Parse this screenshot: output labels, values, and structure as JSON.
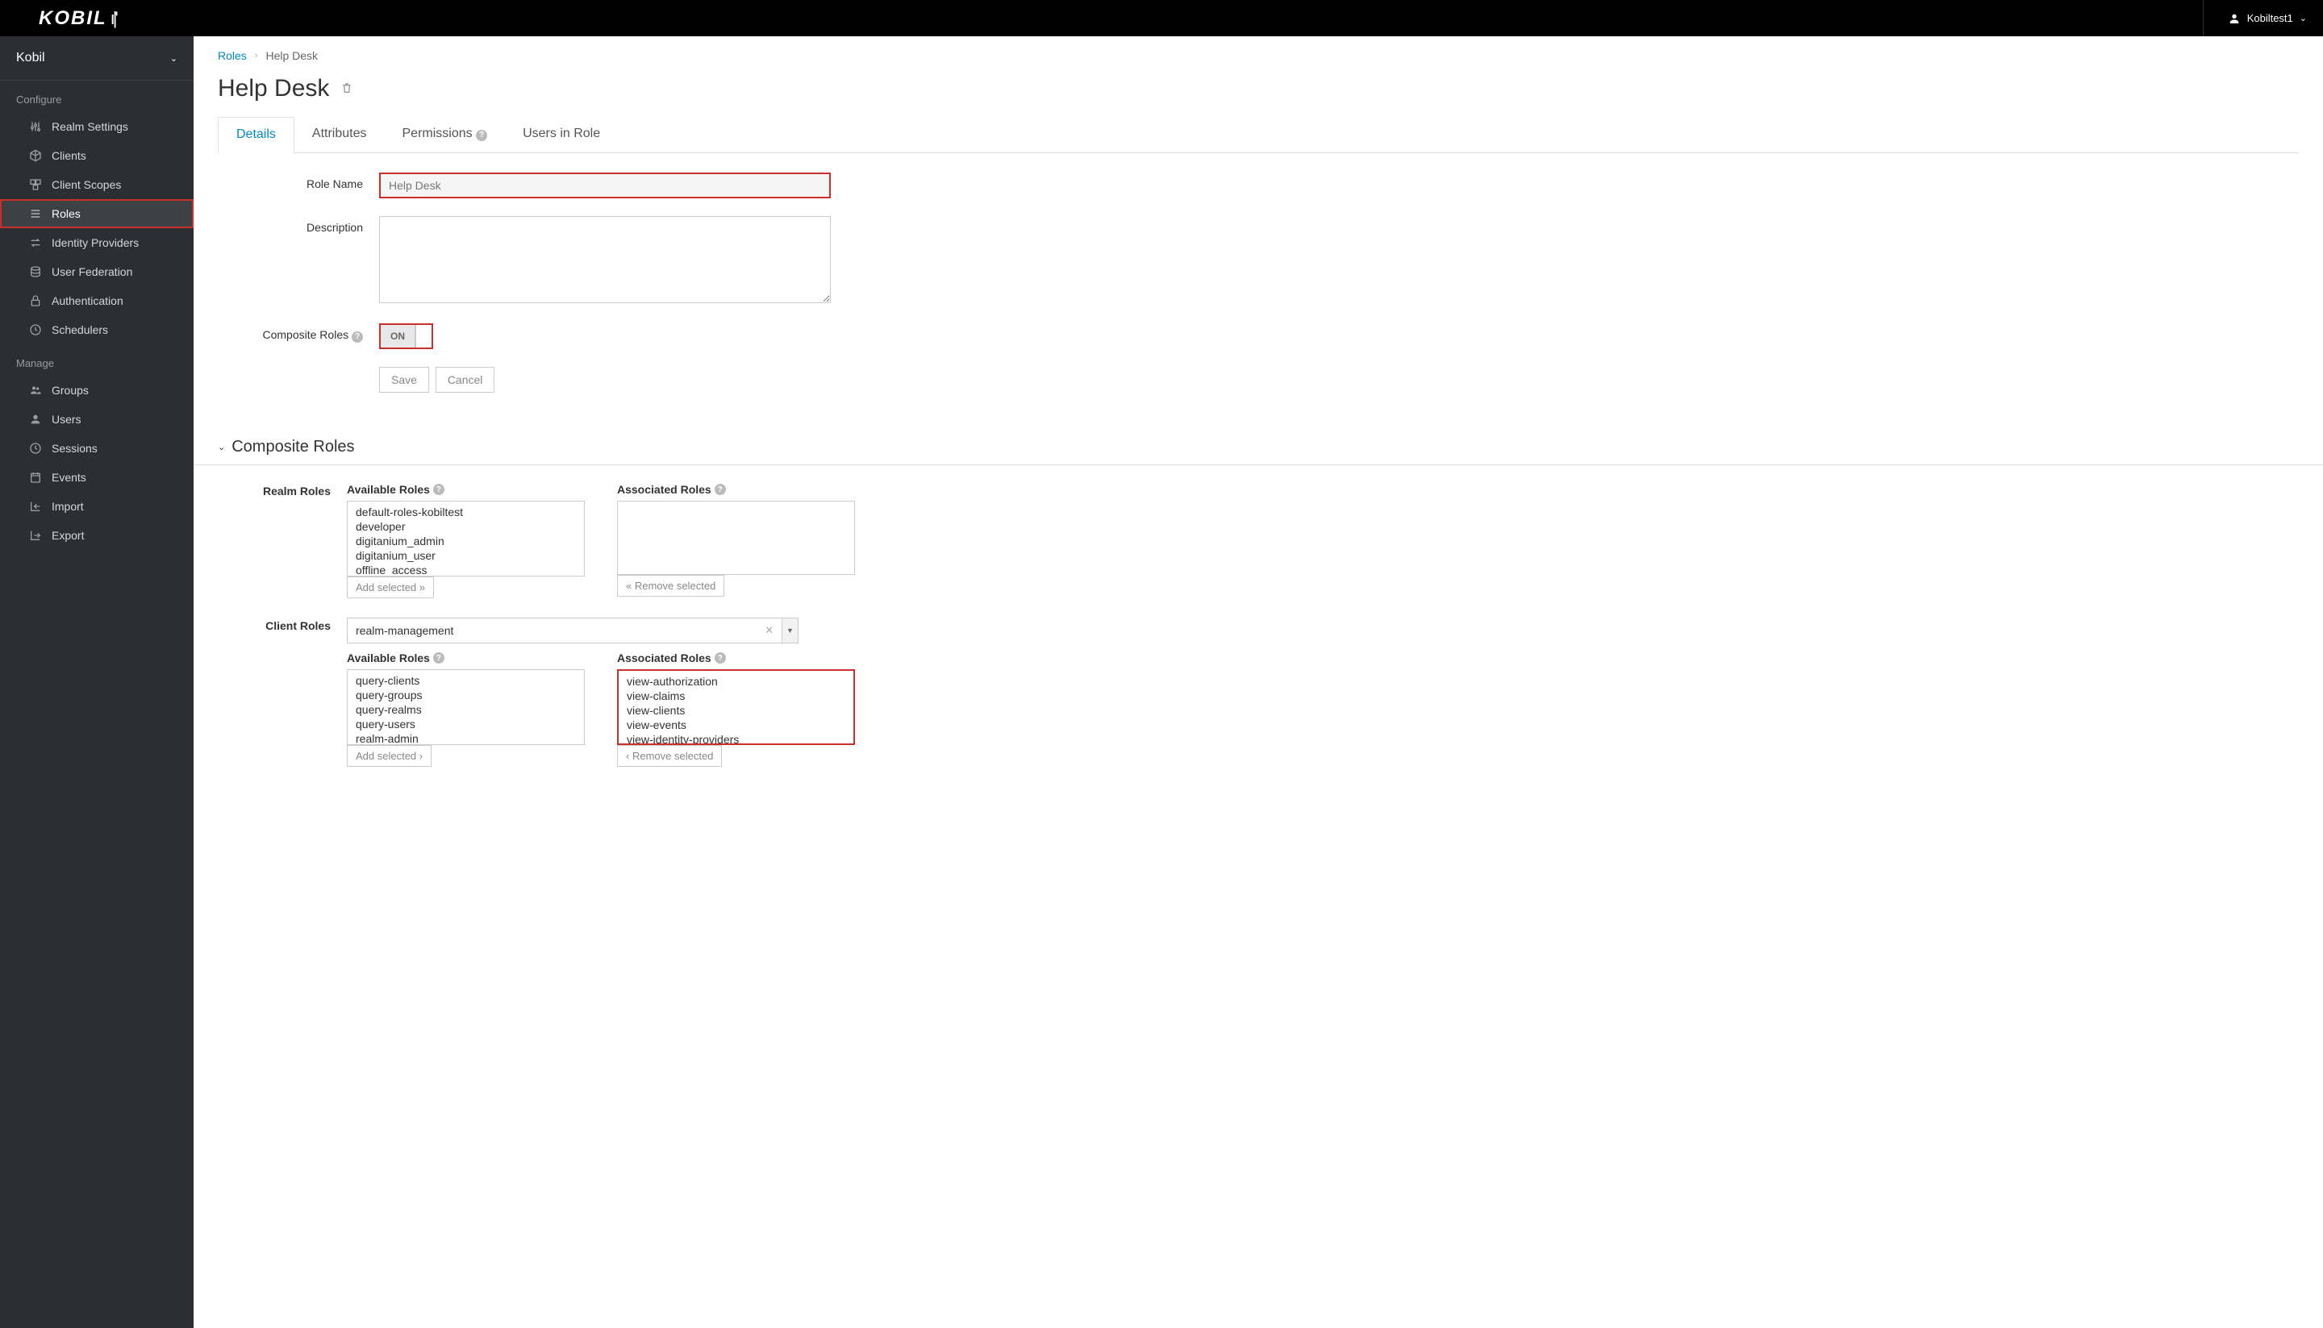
{
  "topbar": {
    "brand": "KOBIL",
    "user_name": "Kobiltest1"
  },
  "sidebar": {
    "realm": "Kobil",
    "group_configure": "Configure",
    "group_manage": "Manage",
    "items_configure": [
      {
        "label": "Realm Settings"
      },
      {
        "label": "Clients"
      },
      {
        "label": "Client Scopes"
      },
      {
        "label": "Roles"
      },
      {
        "label": "Identity Providers"
      },
      {
        "label": "User Federation"
      },
      {
        "label": "Authentication"
      },
      {
        "label": "Schedulers"
      }
    ],
    "items_manage": [
      {
        "label": "Groups"
      },
      {
        "label": "Users"
      },
      {
        "label": "Sessions"
      },
      {
        "label": "Events"
      },
      {
        "label": "Import"
      },
      {
        "label": "Export"
      }
    ]
  },
  "breadcrumb": {
    "parent": "Roles",
    "current": "Help Desk"
  },
  "page": {
    "title": "Help Desk"
  },
  "tabs": {
    "details": "Details",
    "attributes": "Attributes",
    "permissions": "Permissions",
    "users_in_role": "Users in Role"
  },
  "form": {
    "role_name_label": "Role Name",
    "role_name_value": "Help Desk",
    "description_label": "Description",
    "description_value": "",
    "composite_label": "Composite Roles",
    "toggle_on": "ON",
    "save": "Save",
    "cancel": "Cancel"
  },
  "composite": {
    "section_title": "Composite Roles",
    "realm_roles_label": "Realm Roles",
    "client_roles_label": "Client Roles",
    "available_label": "Available Roles",
    "associated_label": "Associated Roles",
    "add_selected": "Add selected",
    "remove_selected": "Remove selected",
    "realm_available": [
      "default-roles-kobiltest",
      "developer",
      "digitanium_admin",
      "digitanium_user",
      "offline_access"
    ],
    "realm_associated": [],
    "client_select_value": "realm-management",
    "client_available": [
      "query-clients",
      "query-groups",
      "query-realms",
      "query-users",
      "realm-admin"
    ],
    "client_associated": [
      "view-authorization",
      "view-claims",
      "view-clients",
      "view-events",
      "view-identity-providers"
    ]
  }
}
